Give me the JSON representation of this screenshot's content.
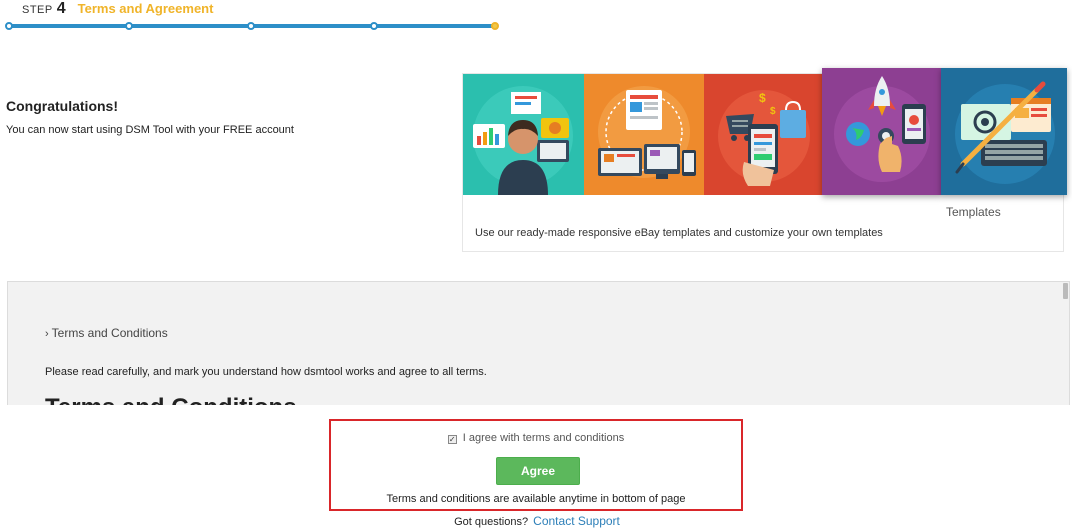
{
  "step": {
    "word": "STEP",
    "number": "4",
    "title": "Terms and Agreement",
    "accent_color": "#f0b429",
    "track_color": "#2d8fc8",
    "total_steps": 5,
    "current_step": 5
  },
  "congrats": {
    "title": "Congratulations!",
    "text": "You can now start using DSM Tool with your FREE account"
  },
  "feature_card": {
    "tiles": [
      {
        "icon": "analyst-chart-icon",
        "color": "#2bbfae"
      },
      {
        "icon": "devices-layout-icon",
        "color": "#ee8a2c"
      },
      {
        "icon": "mobile-shopping-icon",
        "color": "#d9452e"
      },
      {
        "icon": "rocket-touch-icon",
        "color": "#8d3f92"
      },
      {
        "icon": "keyboard-design-icon",
        "color": "#1f6e9c"
      }
    ],
    "active_caption": "Templates",
    "description": "Use our ready-made responsive eBay templates and customize your own templates"
  },
  "terms": {
    "link_label": "Terms and Conditions",
    "instruction": "Please read carefully, and mark you understand how dsmtool works and agree to all terms.",
    "heading": "Terms and Conditions"
  },
  "agreement": {
    "checkbox_label": "I agree with terms and conditions",
    "checked": true,
    "button_label": "Agree",
    "note": "Terms and conditions are available anytime in bottom of page",
    "highlight_color": "#d9262a",
    "button_color": "#5cb85c"
  },
  "footer": {
    "question": "Got questions?",
    "support_label": "Contact Support"
  }
}
